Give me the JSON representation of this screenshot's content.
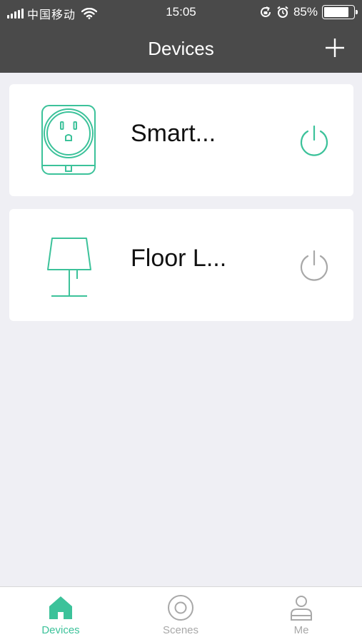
{
  "status_bar": {
    "carrier": "中国移动",
    "time": "15:05",
    "battery_text": "85%",
    "battery_level": 0.85
  },
  "nav": {
    "title": "Devices",
    "add_icon": "plus-icon"
  },
  "devices": [
    {
      "name": "Smart...",
      "icon": "smart-plug-icon",
      "power_on": true
    },
    {
      "name": "Floor L...",
      "icon": "floor-lamp-icon",
      "power_on": false
    }
  ],
  "tabbar": {
    "tabs": [
      {
        "label": "Devices",
        "icon": "home-icon",
        "active": true
      },
      {
        "label": "Scenes",
        "icon": "scenes-icon",
        "active": false
      },
      {
        "label": "Me",
        "icon": "person-icon",
        "active": false
      }
    ]
  },
  "colors": {
    "accent": "#3cc29a",
    "header_bg": "#4a4a4a",
    "background": "#efeff4",
    "inactive": "#a8a8a8"
  }
}
